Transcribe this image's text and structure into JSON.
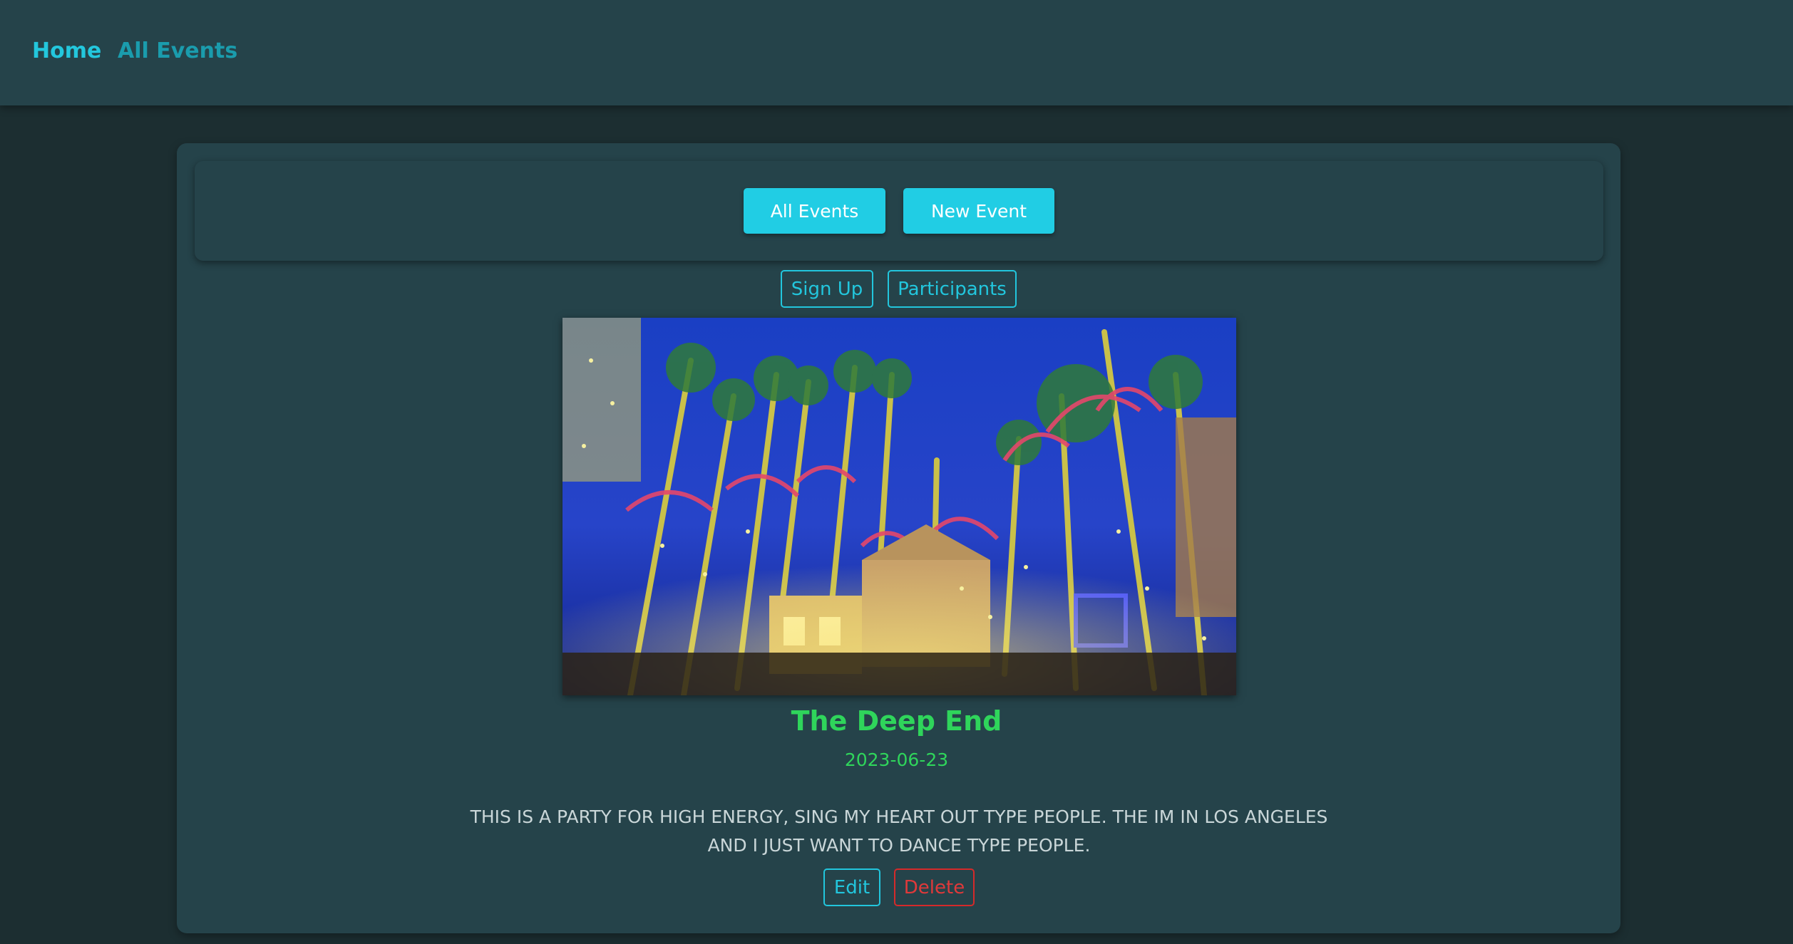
{
  "nav": {
    "home": "Home",
    "all_events": "All Events"
  },
  "toolbar": {
    "all_events": "All Events",
    "new_event": "New Event"
  },
  "actions": {
    "sign_up": "Sign Up",
    "participants": "Participants"
  },
  "event": {
    "image_icon": "event-photo-icon",
    "title": "The Deep End",
    "date": "2023-06-23",
    "description": "THIS IS A PARTY FOR HIGH ENERGY, SING MY HEART OUT TYPE PEOPLE. THE IM IN LOS ANGELES AND I JUST WANT TO DANCE TYPE PEOPLE."
  },
  "manage": {
    "edit": "Edit",
    "delete": "Delete"
  },
  "colors": {
    "accent": "#21cde4",
    "title_green": "#2fd55b",
    "danger": "#e0393a",
    "background": "#1c2e31",
    "panel": "#25434a"
  }
}
